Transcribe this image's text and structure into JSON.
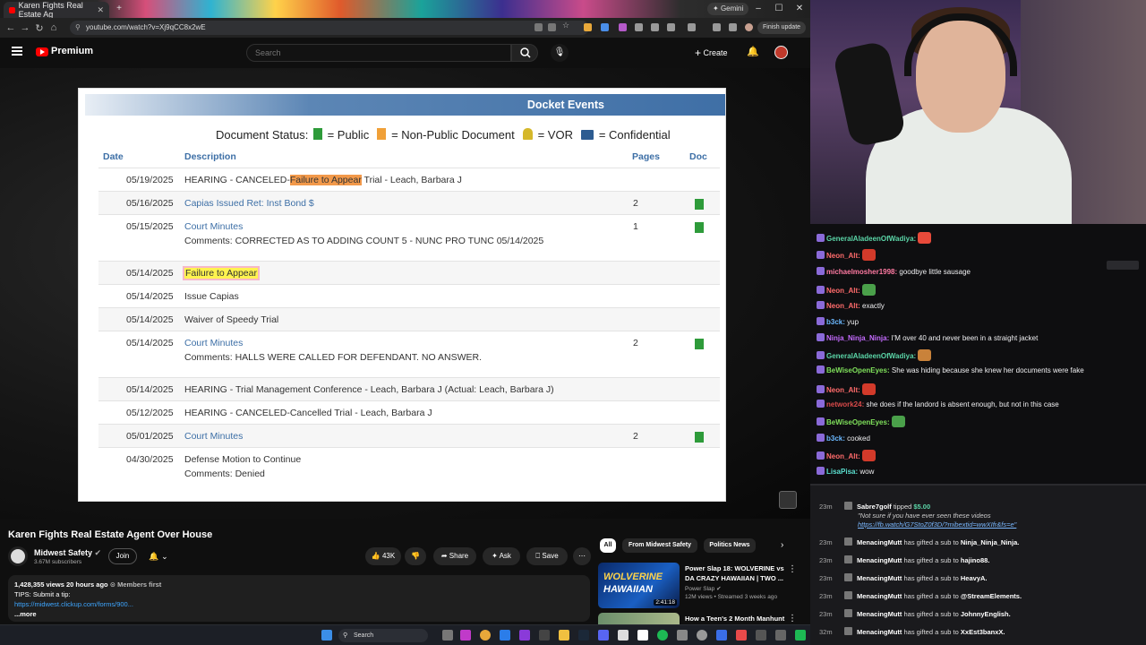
{
  "browser": {
    "tab_title": "Karen Fights Real Estate Ag",
    "gemini_label": "Gemini",
    "url": "youtube.com/watch?v=Xj9qCC8x2wE",
    "finish_update": "Finish update"
  },
  "youtube": {
    "brand": "Premium",
    "search_placeholder": "Search",
    "create_label": "Create"
  },
  "docket": {
    "header": "Docket Events",
    "legend": {
      "prefix": "Document Status:",
      "public": "= Public",
      "non_public": "= Non-Public Document",
      "vor": "= VOR",
      "confidential": "= Confidential"
    },
    "columns": {
      "date": "Date",
      "description": "Description",
      "pages": "Pages",
      "doc": "Doc"
    },
    "rows": [
      {
        "date": "05/19/2025",
        "desc_pre": "HEARING - CANCELED-",
        "desc_hl": "Failure to Appear",
        "desc_post": " Trial - Leach, Barbara J",
        "pages": "",
        "doc": false
      },
      {
        "date": "05/16/2025",
        "desc": "Capias Issued Ret: Inst Bond $",
        "link": true,
        "pages": "2",
        "doc": true
      },
      {
        "date": "05/15/2025",
        "desc": "Court Minutes",
        "link": true,
        "comment": "Comments: CORRECTED AS TO ADDING COUNT 5 - NUNC PRO TUNC 05/14/2025",
        "pages": "1",
        "doc": true
      },
      {
        "date": "05/14/2025",
        "desc_hl_yellow": "Failure to Appear",
        "pages": "",
        "doc": false
      },
      {
        "date": "05/14/2025",
        "desc": "Issue Capias",
        "pages": "",
        "doc": false
      },
      {
        "date": "05/14/2025",
        "desc": "Waiver of Speedy Trial",
        "pages": "",
        "doc": false
      },
      {
        "date": "05/14/2025",
        "desc": "Court Minutes",
        "link": true,
        "comment": "Comments: HALLS WERE CALLED FOR DEFENDANT. NO ANSWER.",
        "pages": "2",
        "doc": true
      },
      {
        "date": "05/14/2025",
        "desc": "HEARING - Trial Management Conference - Leach, Barbara J (Actual: Leach, Barbara J)",
        "pages": "",
        "doc": false
      },
      {
        "date": "05/12/2025",
        "desc": "HEARING - CANCELED-Cancelled Trial - Leach, Barbara J",
        "pages": "",
        "doc": false
      },
      {
        "date": "05/01/2025",
        "desc": "Court Minutes",
        "link": true,
        "pages": "2",
        "doc": true
      },
      {
        "date": "04/30/2025",
        "desc": "Defense Motion to Continue",
        "comment": "Comments: Denied",
        "pages": "",
        "doc": false
      }
    ]
  },
  "video": {
    "title": "Karen Fights Real Estate Agent Over House",
    "channel": "Midwest Safety",
    "subscribers": "3.67M subscribers",
    "join": "Join",
    "likes": "43K",
    "share": "Share",
    "ask": "Ask",
    "save": "Save",
    "desc_meta": "1,428,355 views  20 hours ago  ",
    "desc_members": "Members first",
    "desc_line2": "TIPS: Submit a tip:",
    "desc_link": "https://midwest.clickup.com/forms/900...",
    "desc_more": "...more"
  },
  "related": {
    "chips": [
      "All",
      "From Midwest Safety",
      "Politics News"
    ],
    "items": [
      {
        "title1": "Power Slap 18: WOLVERINE vs",
        "title2": "DA CRAZY HAWAIIAN | TWO ...",
        "channel": "Power Slap",
        "meta": "12M views • Streamed 3 weeks ago",
        "duration": "2:41:18",
        "thumb_text1": "WOLVERINE",
        "thumb_text2": "HAWAIIAN"
      },
      {
        "title1": "How a Teen's 2 Month Manhunt"
      }
    ]
  },
  "taskbar": {
    "search": "Search"
  },
  "chat": [
    {
      "user": "GeneralAladeenOfWadiya",
      "color": "#5bd6a8",
      "text": "",
      "emote": "heart"
    },
    {
      "user": "Neon_Alt",
      "color": "#ff6b6b",
      "text": "",
      "emote": "red"
    },
    {
      "user": "michaelmosher1998",
      "color": "#ff7aa2",
      "text": " goodbye little sausage",
      "emote": ""
    },
    {
      "user": "Neon_Alt",
      "color": "#ff6b6b",
      "text": "",
      "emote": "pepe"
    },
    {
      "user": "Neon_Alt",
      "color": "#ff6b6b",
      "text": " exactly",
      "emote": ""
    },
    {
      "user": "b3ck",
      "color": "#6bb8ff",
      "text": " yup",
      "emote": ""
    },
    {
      "user": "Ninja_Ninja_Ninja",
      "color": "#c56bff",
      "text": " I'M over 40 and never been in a straight jacket",
      "emote": ""
    },
    {
      "user": "GeneralAladeenOfWadiya",
      "color": "#5bd6a8",
      "text": "",
      "emote": "face"
    },
    {
      "user": "BeWiseOpenEyes",
      "color": "#7fe05b",
      "text": " She was hiding because she knew her documents were fake",
      "emote": ""
    },
    {
      "user": "Neon_Alt",
      "color": "#ff6b6b",
      "text": "",
      "emote": "red"
    },
    {
      "user": "network24",
      "color": "#d94a4a",
      "text": " she does if the landord is absent enough, but not in this case",
      "emote": ""
    },
    {
      "user": "BeWiseOpenEyes",
      "color": "#7fe05b",
      "text": "",
      "emote": "pepe"
    },
    {
      "user": "b3ck",
      "color": "#6bb8ff",
      "text": " cooked",
      "emote": ""
    },
    {
      "user": "Neon_Alt",
      "color": "#ff6b6b",
      "text": "",
      "emote": "red"
    },
    {
      "user": "LisaPisa",
      "color": "#5be0d0",
      "text": " wow",
      "emote": ""
    }
  ],
  "feed": [
    {
      "ago": "23m",
      "user": "Sabre7golf",
      "action": " tipped ",
      "amount": "$5.00",
      "note": "\"Not sure if you have ever seen these videos",
      "note_link": "https://fb.watch/G7StoZ0f3D/?mibextid=wwXIfr&fs=e\""
    },
    {
      "ago": "23m",
      "user": "MenacingMutt",
      "action": " has gifted a sub to ",
      "target": "Ninja_Ninja_Ninja."
    },
    {
      "ago": "23m",
      "user": "MenacingMutt",
      "action": " has gifted a sub to ",
      "target": "hajino88."
    },
    {
      "ago": "23m",
      "user": "MenacingMutt",
      "action": " has gifted a sub to ",
      "target": "HeavyA."
    },
    {
      "ago": "23m",
      "user": "MenacingMutt",
      "action": " has gifted a sub to ",
      "target": "@StreamElements."
    },
    {
      "ago": "23m",
      "user": "MenacingMutt",
      "action": " has gifted a sub to ",
      "target": "JohnnyEnglish."
    },
    {
      "ago": "32m",
      "user": "MenacingMutt",
      "action": " has gifted a sub to ",
      "target": "XxEst3banxX."
    }
  ]
}
